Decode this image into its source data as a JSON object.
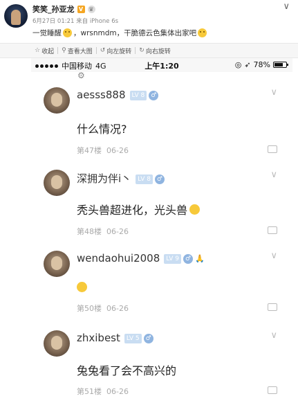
{
  "header": {
    "username": "笑笑_孙亚龙",
    "verified_badge": "V",
    "meta": "6月27日 01:21 来自 iPhone 6s",
    "text_before_emoji": "一觉睡醒",
    "text_after_emoji": "，wrsnmdm，干脆德云色集体出家吧",
    "chevron": "∨"
  },
  "actions": [
    {
      "icon": "star-icon",
      "glyph": "☆",
      "label": "收起"
    },
    {
      "icon": "zoom-icon",
      "glyph": "⚲",
      "label": "查看大图"
    },
    {
      "icon": "rotate-left-icon",
      "glyph": "↺",
      "label": "向左旋转"
    },
    {
      "icon": "rotate-right-icon",
      "glyph": "↻",
      "label": "向右旋转"
    }
  ],
  "status_bar": {
    "carrier": "中国移动",
    "network": "4G",
    "time": "上午1:20",
    "battery": "78%",
    "battery_level": 0.78
  },
  "posts": [
    {
      "username": "aesss888",
      "level": "LV 8",
      "content": "什么情况?",
      "floor": "第47楼",
      "date": "06-26"
    },
    {
      "username": "深拥为伴i丶",
      "level": "LV 8",
      "content": "秃头兽超进化，光头兽",
      "floor": "第48楼",
      "date": "06-26"
    },
    {
      "username": "wendaohui2008",
      "level": "LV 9",
      "content": "",
      "floor": "第50楼",
      "date": "06-26"
    },
    {
      "username": "zhxibest",
      "level": "LV 5",
      "content": "兔兔看了会不高兴的",
      "floor": "第51楼",
      "date": "06-26"
    }
  ],
  "colors": {
    "level_badge": "#c9ddf2",
    "gender_badge": "#8fb4e0",
    "verified": "#f5a623"
  }
}
